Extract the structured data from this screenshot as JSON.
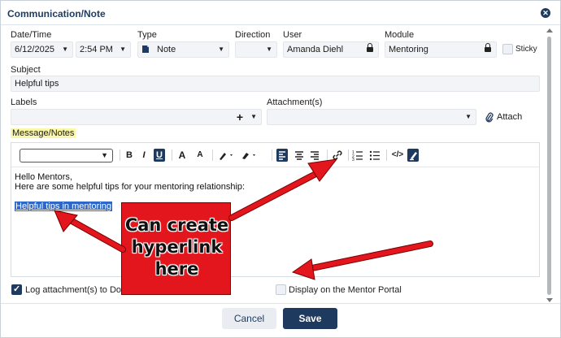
{
  "dialog": {
    "title": "Communication/Note",
    "close_icon": "close-icon"
  },
  "header_fields": {
    "datetime_label": "Date/Time",
    "date_value": "6/12/2025",
    "time_value": "2:54 PM",
    "type_label": "Type",
    "type_value": "Note",
    "direction_label": "Direction",
    "direction_value": "",
    "user_label": "User",
    "user_value": "Amanda Diehl",
    "module_label": "Module",
    "module_value": "Mentoring",
    "sticky_label": "Sticky"
  },
  "subject": {
    "label": "Subject",
    "value": "Helpful tips"
  },
  "labels": {
    "label": "Labels",
    "add_glyph": "+"
  },
  "attachments": {
    "label": "Attachment(s)",
    "attach_label": "Attach"
  },
  "message": {
    "label": "Message/Notes",
    "line1": "Hello Mentors,",
    "line2": "Here are some helpful tips for your mentoring relationship:",
    "link_text": "Helpful tips in mentoring"
  },
  "toolbar": {
    "bold": "B",
    "italic": "I",
    "underline": "U",
    "increase_font": "A",
    "decrease_font": "A",
    "code": "</>"
  },
  "options": {
    "log_attachments_label": "Log attachment(s) to Doc",
    "log_attachments_checked": true,
    "mentor_portal_label": "Display on the Mentor Portal",
    "mentor_portal_checked": false
  },
  "footer": {
    "cancel_label": "Cancel",
    "save_label": "Save"
  },
  "annotation": {
    "callout_line1": "Can create",
    "callout_line2": "hyperlink",
    "callout_line3": "here",
    "callout_color": "#e3161d"
  },
  "colors": {
    "brand": "#1f3a5f",
    "highlight": "#fbf7a8",
    "link_selection": "#2e67c7"
  }
}
